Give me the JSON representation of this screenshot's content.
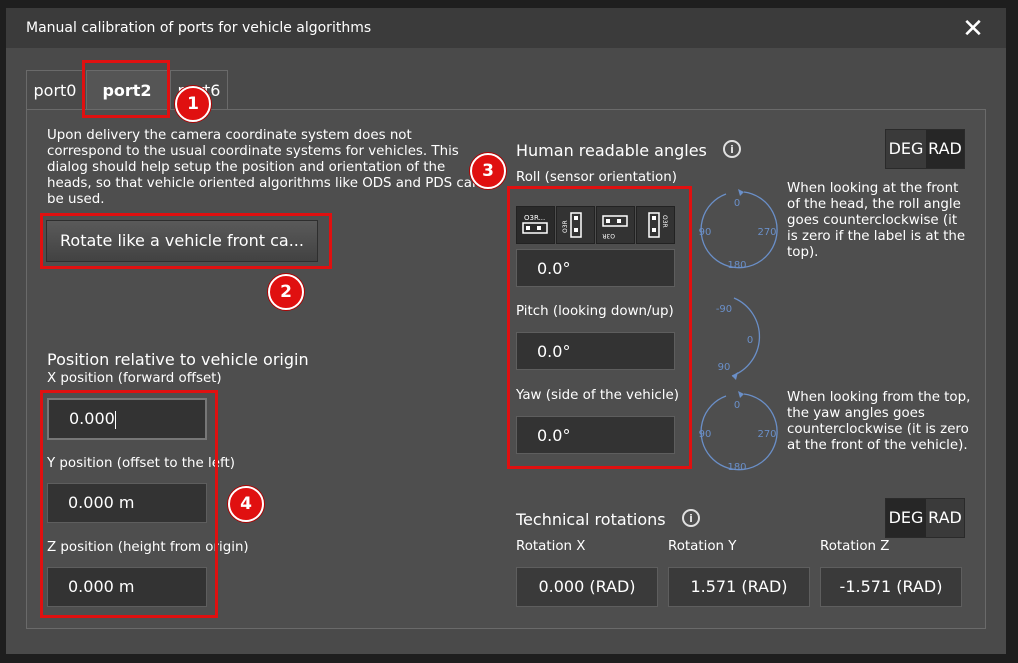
{
  "dialog": {
    "title": "Manual calibration of ports for vehicle algorithms",
    "close_glyph": "✕"
  },
  "tabs": [
    {
      "label": "port0",
      "active": false
    },
    {
      "label": "port2",
      "active": true
    },
    {
      "label": "port6",
      "active": false
    }
  ],
  "intro": {
    "text": "Upon delivery the camera coordinate system does not correspond to the usual coordinate systems for vehicles. This dialog should help setup the position and orientation of the heads, so that vehicle oriented algorithms like ODS and PDS can be used.",
    "rotate_button": "Rotate like a vehicle front ca..."
  },
  "position": {
    "title": "Position relative to vehicle origin",
    "x_label": "X position (forward offset)",
    "x_value": "0.000",
    "y_label": "Y position (offset to the left)",
    "y_value": "0.000 m",
    "z_label": "Z position (height from origin)",
    "z_value": "0.000 m"
  },
  "angles": {
    "title": "Human readable angles",
    "unit_deg": "DEG",
    "unit_rad": "RAD",
    "selected_unit": "DEG",
    "roll_label": "Roll (sensor orientation)",
    "roll_value": "0.0°",
    "pitch_label": "Pitch (looking down/up)",
    "pitch_value": "0.0°",
    "yaw_label": "Yaw (side of the vehicle)",
    "yaw_value": "0.0°",
    "roll_desc": "When looking at the front of the head, the roll angle goes counterclockwise (it is zero if the label is at the top).",
    "yaw_desc": "When looking from the top, the yaw angles goes counterclockwise (it is zero at the front of the vehicle).",
    "orientation_label": "O3R...",
    "dial": {
      "top": "0",
      "left": "90",
      "right": "270",
      "bottom": "180"
    },
    "pitch_dial": {
      "top": "-90",
      "mid": "0",
      "bottom": "90"
    }
  },
  "technical": {
    "title": "Technical rotations",
    "unit_deg": "DEG",
    "unit_rad": "RAD",
    "selected_unit": "RAD",
    "rot_x_label": "Rotation X",
    "rot_x_value": "0.000 (RAD)",
    "rot_y_label": "Rotation Y",
    "rot_y_value": "1.571 (RAD)",
    "rot_z_label": "Rotation Z",
    "rot_z_value": "-1.571 (RAD)"
  },
  "badges": [
    "1",
    "2",
    "3",
    "4"
  ],
  "colors": {
    "highlight": "#e01010",
    "dial_blue": "#6a8fc8",
    "panel": "#4e4e4e",
    "field": "#333333"
  }
}
